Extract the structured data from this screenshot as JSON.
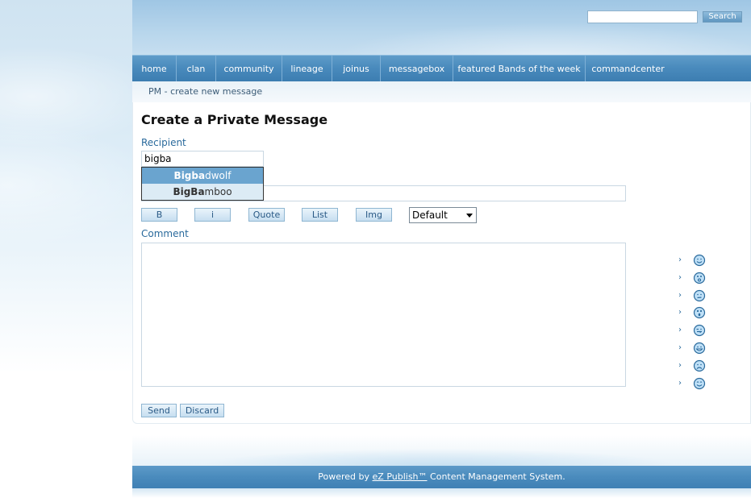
{
  "header": {
    "search_value": "",
    "search_button": "Search"
  },
  "nav": {
    "items": [
      {
        "label": "home"
      },
      {
        "label": "clan"
      },
      {
        "label": "community"
      },
      {
        "label": "lineage"
      },
      {
        "label": "joinus"
      },
      {
        "label": "messagebox"
      },
      {
        "label": "featured Bands of the week"
      },
      {
        "label": "commandcenter"
      }
    ]
  },
  "breadcrumb": "PM - create new message",
  "form": {
    "title": "Create a Private Message",
    "recipient_label": "Recipient",
    "recipient_value": "bigba",
    "autocomplete": [
      {
        "match": "Bigba",
        "rest": "dwolf"
      },
      {
        "match": "BigBa",
        "rest": "mboo"
      }
    ],
    "subject_value": "",
    "format_buttons": [
      "B",
      "i",
      "Quote",
      "List",
      "Img"
    ],
    "color_select": "Default",
    "comment_label": "Comment",
    "comment_value": "",
    "send_button": "Send",
    "discard_button": "Discard"
  },
  "smileys": [
    {
      "icon": "smile-icon",
      "arrow": "›"
    },
    {
      "icon": "surprised-icon",
      "arrow": "›"
    },
    {
      "icon": "confused-icon",
      "arrow": "›"
    },
    {
      "icon": "shocked-icon",
      "arrow": "›"
    },
    {
      "icon": "tongue-icon",
      "arrow": "›"
    },
    {
      "icon": "grin-icon",
      "arrow": "›"
    },
    {
      "icon": "sad-icon",
      "arrow": "›"
    },
    {
      "icon": "happy-icon",
      "arrow": "›"
    }
  ],
  "footer": {
    "prefix": "Powered by ",
    "link": "eZ Publish™",
    "suffix": " Content Management System."
  },
  "colors": {
    "nav": "#4a8bbd",
    "accent_text": "#2a6a9c",
    "dropdown_selected": "#6aa4cf"
  }
}
